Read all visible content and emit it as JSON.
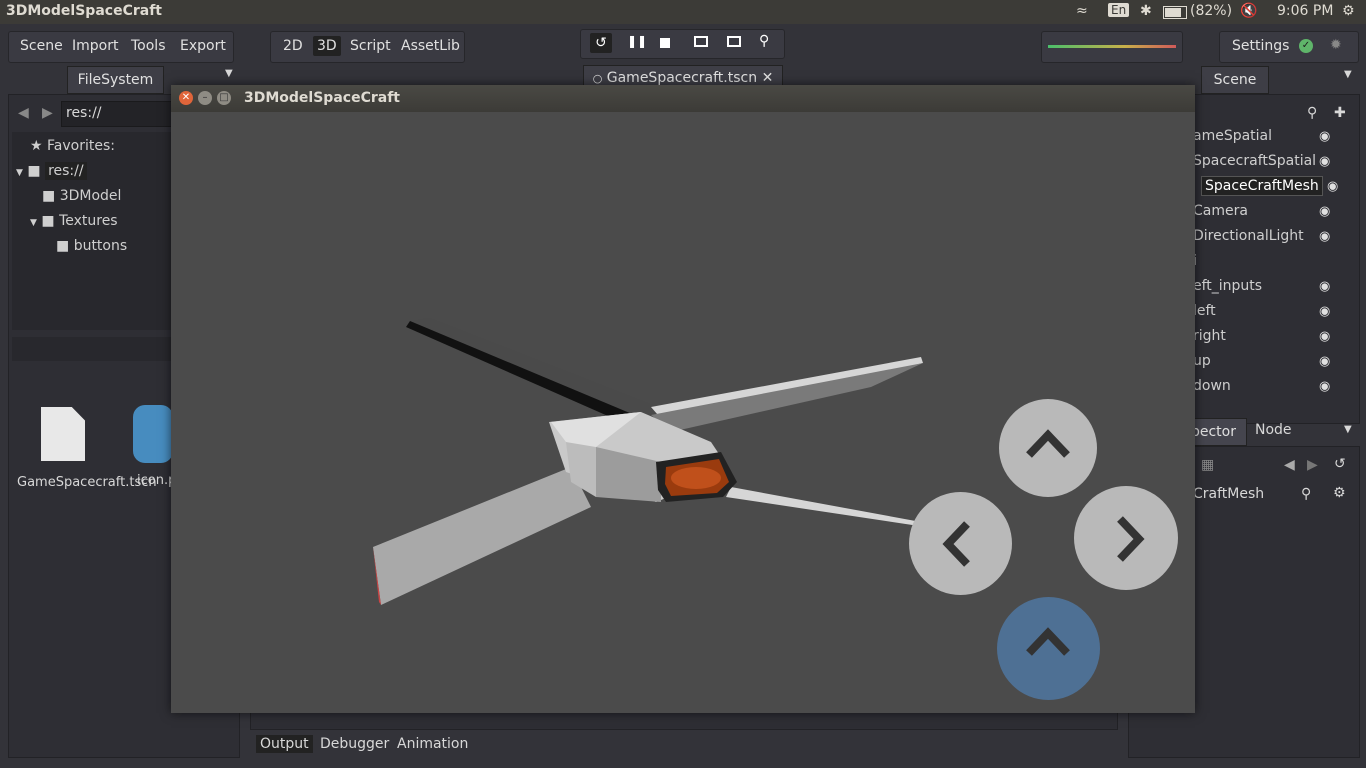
{
  "window_title": "3DModelSpaceCraft",
  "tray": {
    "keyboard": "En",
    "battery": "(82%)",
    "clock": "9:06 PM"
  },
  "menu": [
    "Scene",
    "Import",
    "Tools",
    "Export"
  ],
  "workspaces": [
    "2D",
    "3D",
    "Script",
    "AssetLib"
  ],
  "active_workspace": "3D",
  "settings_label": "Settings",
  "filesystem": {
    "tab": "FileSystem",
    "path": "res://",
    "favorites_label": "Favorites:",
    "tree": [
      "res://",
      "3DModel",
      "Textures",
      "buttons"
    ],
    "files": [
      {
        "name": "GameSpacecraft.tscn"
      },
      {
        "name": "icon.p"
      }
    ]
  },
  "scene_tab": "GameSpacecraft.tscn",
  "scene_dock": {
    "tab": "Scene",
    "nodes": [
      "ameSpatial",
      "SpacecraftSpatial",
      "SpaceCraftMesh",
      "Camera",
      "DirectionalLight",
      "i",
      "eft_inputs",
      "left",
      "right",
      "up",
      "down"
    ],
    "selected": "SpaceCraftMesh"
  },
  "inspector": {
    "tabs": [
      "pector",
      "Node"
    ],
    "object": "CraftMesh"
  },
  "bottom_tabs": [
    "Output",
    "Debugger",
    "Animation"
  ],
  "game_window": {
    "title": "3DModelSpaceCraft",
    "controls": [
      "up-button",
      "left-button",
      "right-button",
      "thrust-button"
    ]
  },
  "colors": {
    "thrust_button": "#4e7094",
    "control_button": "#b9b9b9",
    "viewport": "#4b4b4b"
  }
}
